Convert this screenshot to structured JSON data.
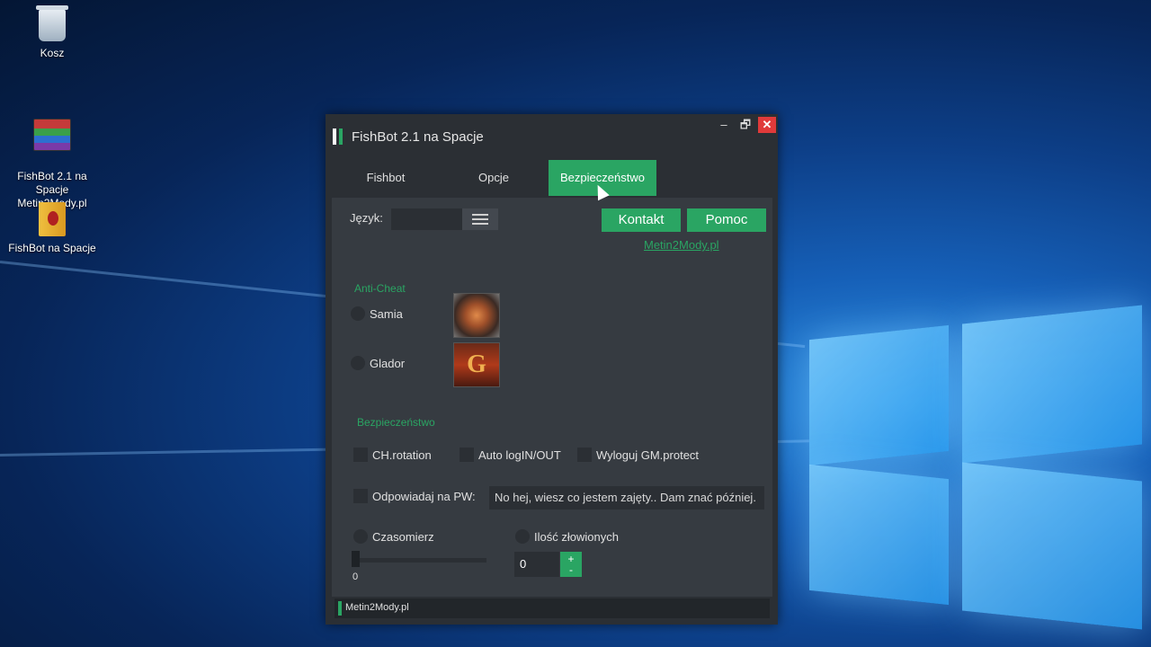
{
  "desktop": {
    "icons": [
      {
        "label": "Kosz"
      },
      {
        "label": "FishBot 2.1 na Spacje\nMetin2Mody.pl"
      },
      {
        "label": "FishBot na Spacje"
      }
    ]
  },
  "window": {
    "title": "FishBot 2.1 na Spacje",
    "controls": {
      "minimize": "–",
      "restore": "🗗",
      "close": "✕"
    },
    "logo_colors": [
      "#ffffff",
      "#2aa563"
    ]
  },
  "tabs": [
    {
      "label": "Fishbot"
    },
    {
      "label": "Opcje"
    },
    {
      "label": "Bezpieczeństwo",
      "active": true
    }
  ],
  "panel": {
    "language_label": "Język:",
    "contact_button": "Kontakt",
    "help_button": "Pomoc",
    "site_link": "Metin2Mody.pl",
    "anticheat_section": "Anti-Cheat",
    "anticheat_options": [
      "Samia",
      "Glador"
    ],
    "glador_logo_letter": "G",
    "security_section": "Bezpieczeństwo",
    "security_options": [
      "CH.rotation",
      "Auto logIN/OUT",
      "Wyloguj GM.protect"
    ],
    "pw_reply_label": "Odpowiadaj na PW:",
    "pw_reply_value": "No hej, wiesz co jestem zajęty.. Dam znać później.",
    "timer_label": "Czasomierz",
    "timer_value": "0",
    "catch_count_label": "Ilość złowionych",
    "catch_count_value": "0",
    "stepper_plus": "+",
    "stepper_minus": "-"
  },
  "status_bar": {
    "text": "Metin2Mody.pl"
  },
  "colors": {
    "accent": "#2aa563",
    "window_bg": "#2b2f34",
    "panel_bg": "#363b41",
    "close": "#e03a3a"
  }
}
